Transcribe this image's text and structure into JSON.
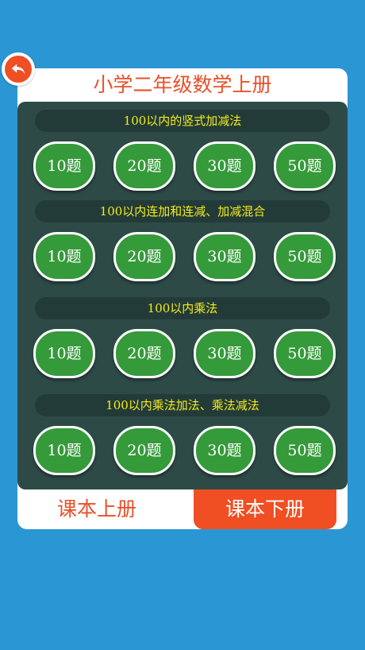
{
  "app": {
    "title": "小学二年级数学上册"
  },
  "sections": [
    {
      "title": "100以内的竖式加减法",
      "buttons": [
        "10题",
        "20题",
        "30题",
        "50题"
      ]
    },
    {
      "title": "100以内连加和连减、加减混合",
      "buttons": [
        "10题",
        "20题",
        "30题",
        "50题"
      ]
    },
    {
      "title": "100以内乘法",
      "buttons": [
        "10题",
        "20题",
        "30题",
        "50题"
      ]
    },
    {
      "title": "100以内乘法加法、乘法减法",
      "buttons": [
        "10题",
        "20题",
        "30题",
        "50题"
      ]
    }
  ],
  "tabs": {
    "upper": "课本上册",
    "lower": "课本下册",
    "selected": "lower"
  },
  "colors": {
    "background": "#2b96d4",
    "accent": "#f04e23",
    "board": "#2d4a47",
    "section_header_text": "#f3ec1c",
    "button_green": "#359a3a"
  },
  "icons": {
    "back": "back-arrow-icon"
  }
}
